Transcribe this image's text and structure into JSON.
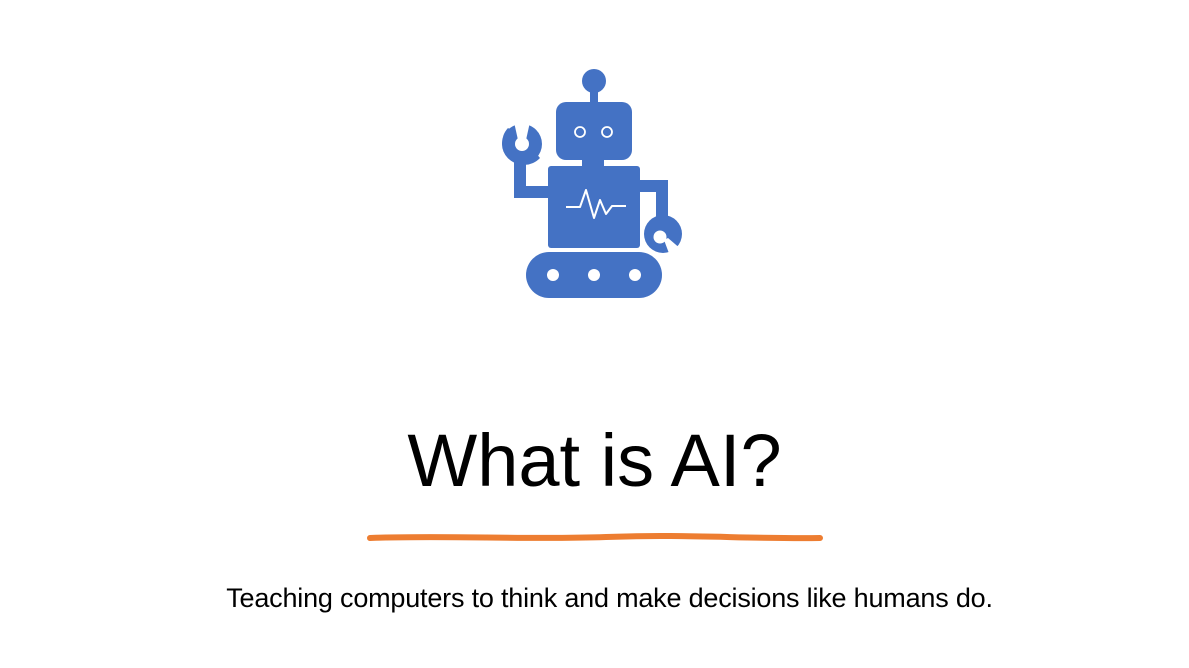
{
  "slide": {
    "title": "What is AI?",
    "subtitle": "Teaching computers to think and make decisions like humans do.",
    "icon": "robot-icon",
    "colors": {
      "icon": "#4472C4",
      "accent_underline": "#ED7D31",
      "text": "#000000",
      "background": "#FFFFFF"
    }
  }
}
